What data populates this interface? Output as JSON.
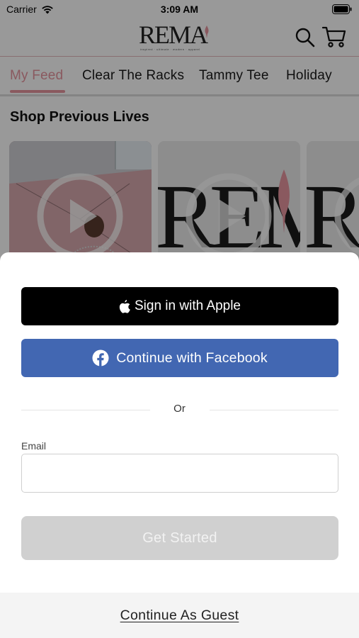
{
  "status_bar": {
    "carrier": "Carrier",
    "time": "3:09 AM"
  },
  "header": {
    "logo_text": "REMA",
    "logo_tagline": "inspired · ultimate · modern · apparel",
    "icons": [
      "search-icon",
      "cart-icon"
    ]
  },
  "tabs": [
    {
      "label": "My Feed",
      "active": true
    },
    {
      "label": "Clear The Racks",
      "active": false
    },
    {
      "label": "Tammy Tee",
      "active": false
    },
    {
      "label": "Holiday",
      "active": false
    }
  ],
  "section": {
    "title": "Shop Previous Lives",
    "cards": [
      {
        "kind": "photo",
        "icon": "play-icon"
      },
      {
        "kind": "logo",
        "icon": "play-icon"
      },
      {
        "kind": "logo",
        "icon": "play-icon"
      }
    ]
  },
  "sheet": {
    "apple_label": "Sign in with Apple",
    "facebook_label": "Continue with Facebook",
    "or_label": "Or",
    "email_label": "Email",
    "email_value": "",
    "get_started_label": "Get Started",
    "guest_label": "Continue As Guest"
  },
  "colors": {
    "accent_pink": "#e6949e",
    "facebook_blue": "#4267b2",
    "apple_black": "#000000",
    "disabled_gray": "#d0d0d0"
  }
}
